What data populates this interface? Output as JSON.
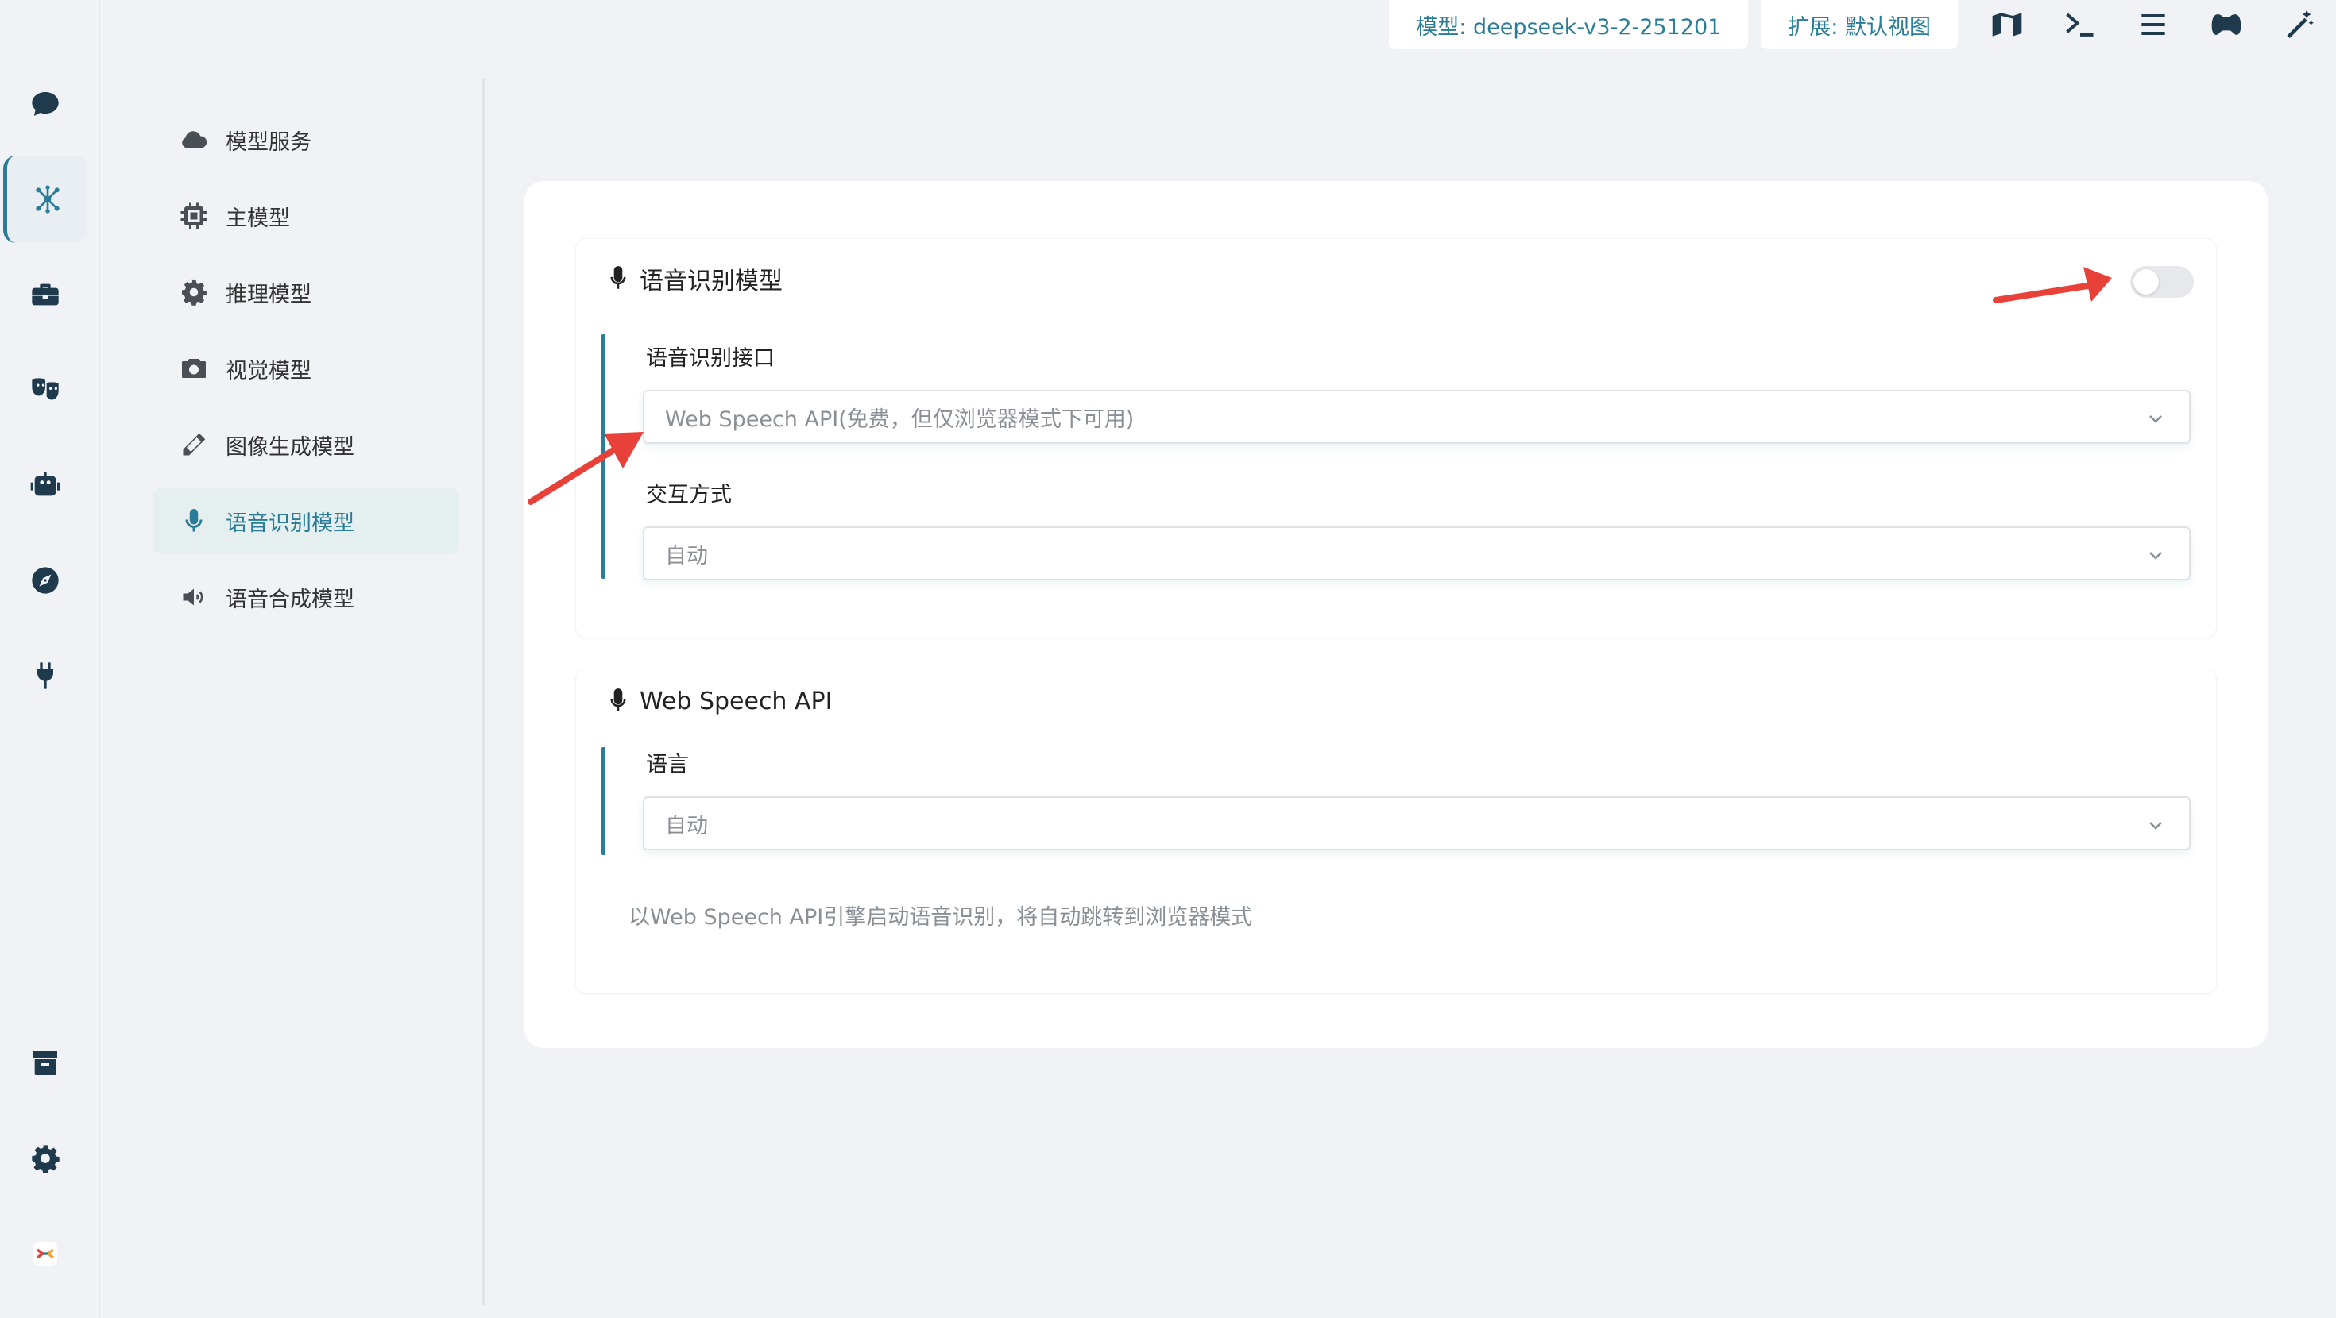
{
  "topbar": {
    "model_chip": "模型: deepseek-v3-2-251201",
    "extension_chip": "扩展: 默认视图",
    "icons": [
      "map-icon",
      "terminal-icon",
      "menu-icon",
      "gamepad-icon",
      "magic-wand-icon"
    ]
  },
  "rail": {
    "items": [
      "chat-icon",
      "model-hub-icon",
      "toolbox-icon",
      "theater-masks-icon",
      "robot-icon",
      "compass-icon",
      "plug-icon"
    ],
    "bottom": [
      "archive-icon",
      "settings-icon",
      "app-logo-icon"
    ],
    "active": "model-hub-icon"
  },
  "subnav": {
    "items": [
      {
        "label": "模型服务",
        "icon": "cloud-icon"
      },
      {
        "label": "主模型",
        "icon": "chip-icon"
      },
      {
        "label": "推理模型",
        "icon": "gear-cog-icon"
      },
      {
        "label": "视觉模型",
        "icon": "camera-icon"
      },
      {
        "label": "图像生成模型",
        "icon": "pencil-icon"
      },
      {
        "label": "语音识别模型",
        "icon": "microphone-icon"
      },
      {
        "label": "语音合成模型",
        "icon": "speaker-icon"
      }
    ],
    "active_index": 5
  },
  "main": {
    "asr_section": {
      "title": "语音识别模型",
      "toggle_on": false,
      "interface_label": "语音识别接口",
      "interface_value": "Web Speech API(免费，但仅浏览器模式下可用)",
      "interaction_label": "交互方式",
      "interaction_value": "自动"
    },
    "webspeech_section": {
      "title": "Web Speech API",
      "language_label": "语言",
      "language_value": "自动",
      "hint": "以Web Speech API引擎启动语音识别，将自动跳转到浏览器模式"
    }
  },
  "colors": {
    "accent": "#2a7d96",
    "annotation_arrow": "#e8413a",
    "background": "#f0f2f5"
  }
}
